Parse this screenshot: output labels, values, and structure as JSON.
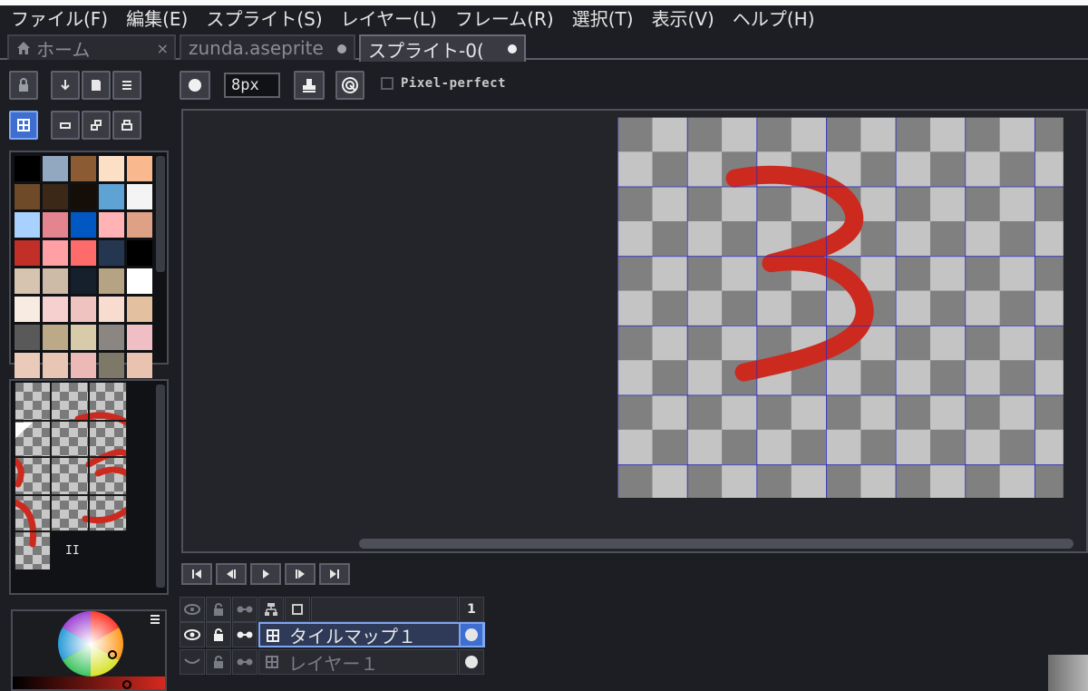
{
  "menu": [
    "ファイル(F)",
    "編集(E)",
    "スプライト(S)",
    "レイヤー(L)",
    "フレーム(R)",
    "選択(T)",
    "表示(V)",
    "ヘルプ(H)"
  ],
  "tabs": [
    {
      "label": "ホーム",
      "marker": "×"
    },
    {
      "label": "zunda.aseprite",
      "marker": "●"
    },
    {
      "label": "スプライト-0(",
      "marker": "●"
    }
  ],
  "toolbar": {
    "brush_size": "8px",
    "pixel_perfect_label": "Pixel-perfect",
    "pixel_perfect_checked": false
  },
  "palette": [
    "#000000",
    "#91a8c0",
    "#8b5b33",
    "#fce0c6",
    "#f9b88e",
    "#6f4a28",
    "#3b2816",
    "#140d08",
    "#5fa2d4",
    "#f4f4f4",
    "#a8d1ff",
    "#e4848f",
    "#0158c3",
    "#ffb3b4",
    "#dea185",
    "#c22e28",
    "#ffa0a4",
    "#ff6b6b",
    "#253651",
    "#000000",
    "#d7c4b0",
    "#cdbba7",
    "#15202c",
    "#b5a383",
    "#ffffff",
    "#f7ebe2",
    "#f6cfcf",
    "#efc3c0",
    "#f8dccf",
    "#e3c0a0",
    "#595959",
    "#bca987",
    "#d8cbaa",
    "#8b8681",
    "#f0bfc6",
    "#eacab9",
    "#e7c6b4",
    "#ecb9b6",
    "#7e7868",
    "#e9c2b0"
  ],
  "tileset": {
    "page_indicator": "II"
  },
  "timeline": {
    "frame_number": "1",
    "layers": [
      {
        "name": "タイルマップ１",
        "selected": true
      },
      {
        "name": "レイヤー１",
        "selected": false
      }
    ]
  },
  "colors": {
    "accent": "#3e6fd0",
    "stroke": "#cc2a1f",
    "grid": "#2323c8"
  }
}
